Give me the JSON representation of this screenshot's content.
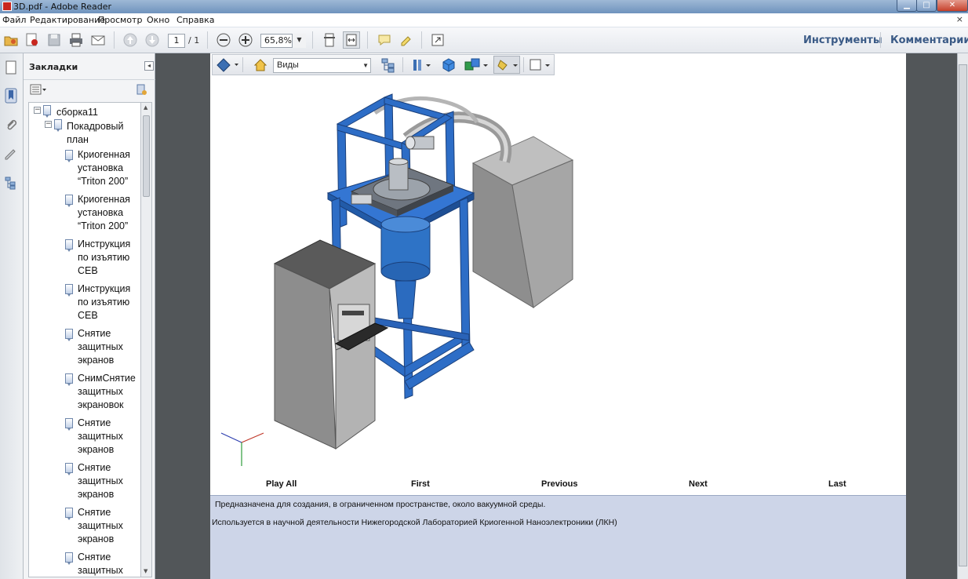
{
  "window": {
    "title": "3D.pdf - Adobe Reader"
  },
  "menu": {
    "items": [
      "Файл",
      "Редактирование",
      "Просмотр",
      "Окно",
      "Справка"
    ],
    "close_label": "×"
  },
  "toolbar": {
    "page_current": "1",
    "page_total": "/ 1",
    "zoom": "65,8%",
    "tools_label": "Инструменты",
    "comments_label": "Комментарии"
  },
  "bookmarks": {
    "title": "Закладки",
    "collapse_glyph": "◂",
    "root": "сборка11",
    "group": [
      "Покадровый",
      "план"
    ],
    "items": [
      [
        "Криогенная",
        "установка",
        "“Triton 200”"
      ],
      [
        "Криогенная",
        "установка",
        "“Triton 200”"
      ],
      [
        "Инструкция",
        "по изъятию",
        "CEB"
      ],
      [
        "Инструкция",
        "по изъятию",
        "CEB"
      ],
      [
        "Снятие",
        "защитных",
        "экранов"
      ],
      [
        "СнимСнятие",
        "защитных",
        "экрановок"
      ],
      [
        "Снятие",
        "защитных",
        "экранов"
      ],
      [
        "Снятие",
        "защитных",
        "экранов"
      ],
      [
        "Снятие",
        "защитных",
        "экранов"
      ],
      [
        "Снятие",
        "защитных",
        ""
      ]
    ]
  },
  "viewer3d": {
    "views_label": "Виды"
  },
  "animation": {
    "play_all": "Play All",
    "first": "First",
    "previous": "Previous",
    "next": "Next",
    "last": "Last"
  },
  "description": {
    "line1": "Предназначена  для создания, в ограниченном  пространстве,  около вакуумной среды.",
    "line2": "Используется в научной деятельности Нижегородской Лабораторией Криогенной Наноэлектроники (ЛКН)"
  },
  "colors": {
    "frame_blue": "#2c6fc9",
    "cabinet_gray": "#8a8a8a",
    "desc_bg": "#cdd5e8",
    "link_blue": "#3a5a86"
  }
}
